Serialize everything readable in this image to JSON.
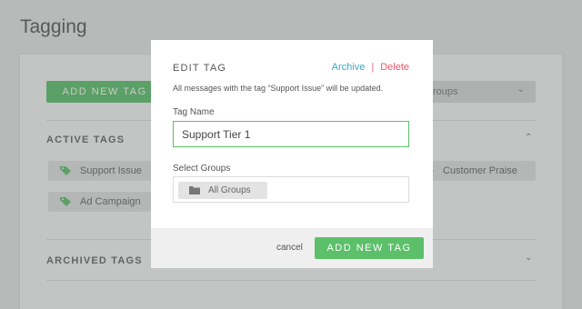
{
  "page": {
    "title": "Tagging",
    "add_button_label": "ADD NEW TAG",
    "groups_select_value": "roups",
    "active_section_title": "ACTIVE TAGS",
    "archived_section_title": "ARCHIVED TAGS",
    "tags": [
      "Support Issue",
      "Ad Campaign",
      "Customer Praise"
    ]
  },
  "modal": {
    "title": "EDIT TAG",
    "archive_label": "Archive",
    "separator": "|",
    "delete_label": "Delete",
    "description": "All messages with the tag “Support Issue” will be updated.",
    "name_label": "Tag Name",
    "name_value": "Support Tier 1",
    "groups_label": "Select Groups",
    "group_chip": "All Groups",
    "cancel_label": "cancel",
    "submit_label": "ADD NEW TAG"
  },
  "colors": {
    "accent_green": "#5cc06a",
    "link_blue": "#3aa7c4",
    "delete_red": "#e8566a"
  },
  "icons": {
    "tag": "tag-icon",
    "folder": "folder-icon",
    "chevron_down": "chevron-down-icon",
    "chevron_up": "chevron-up-icon"
  }
}
